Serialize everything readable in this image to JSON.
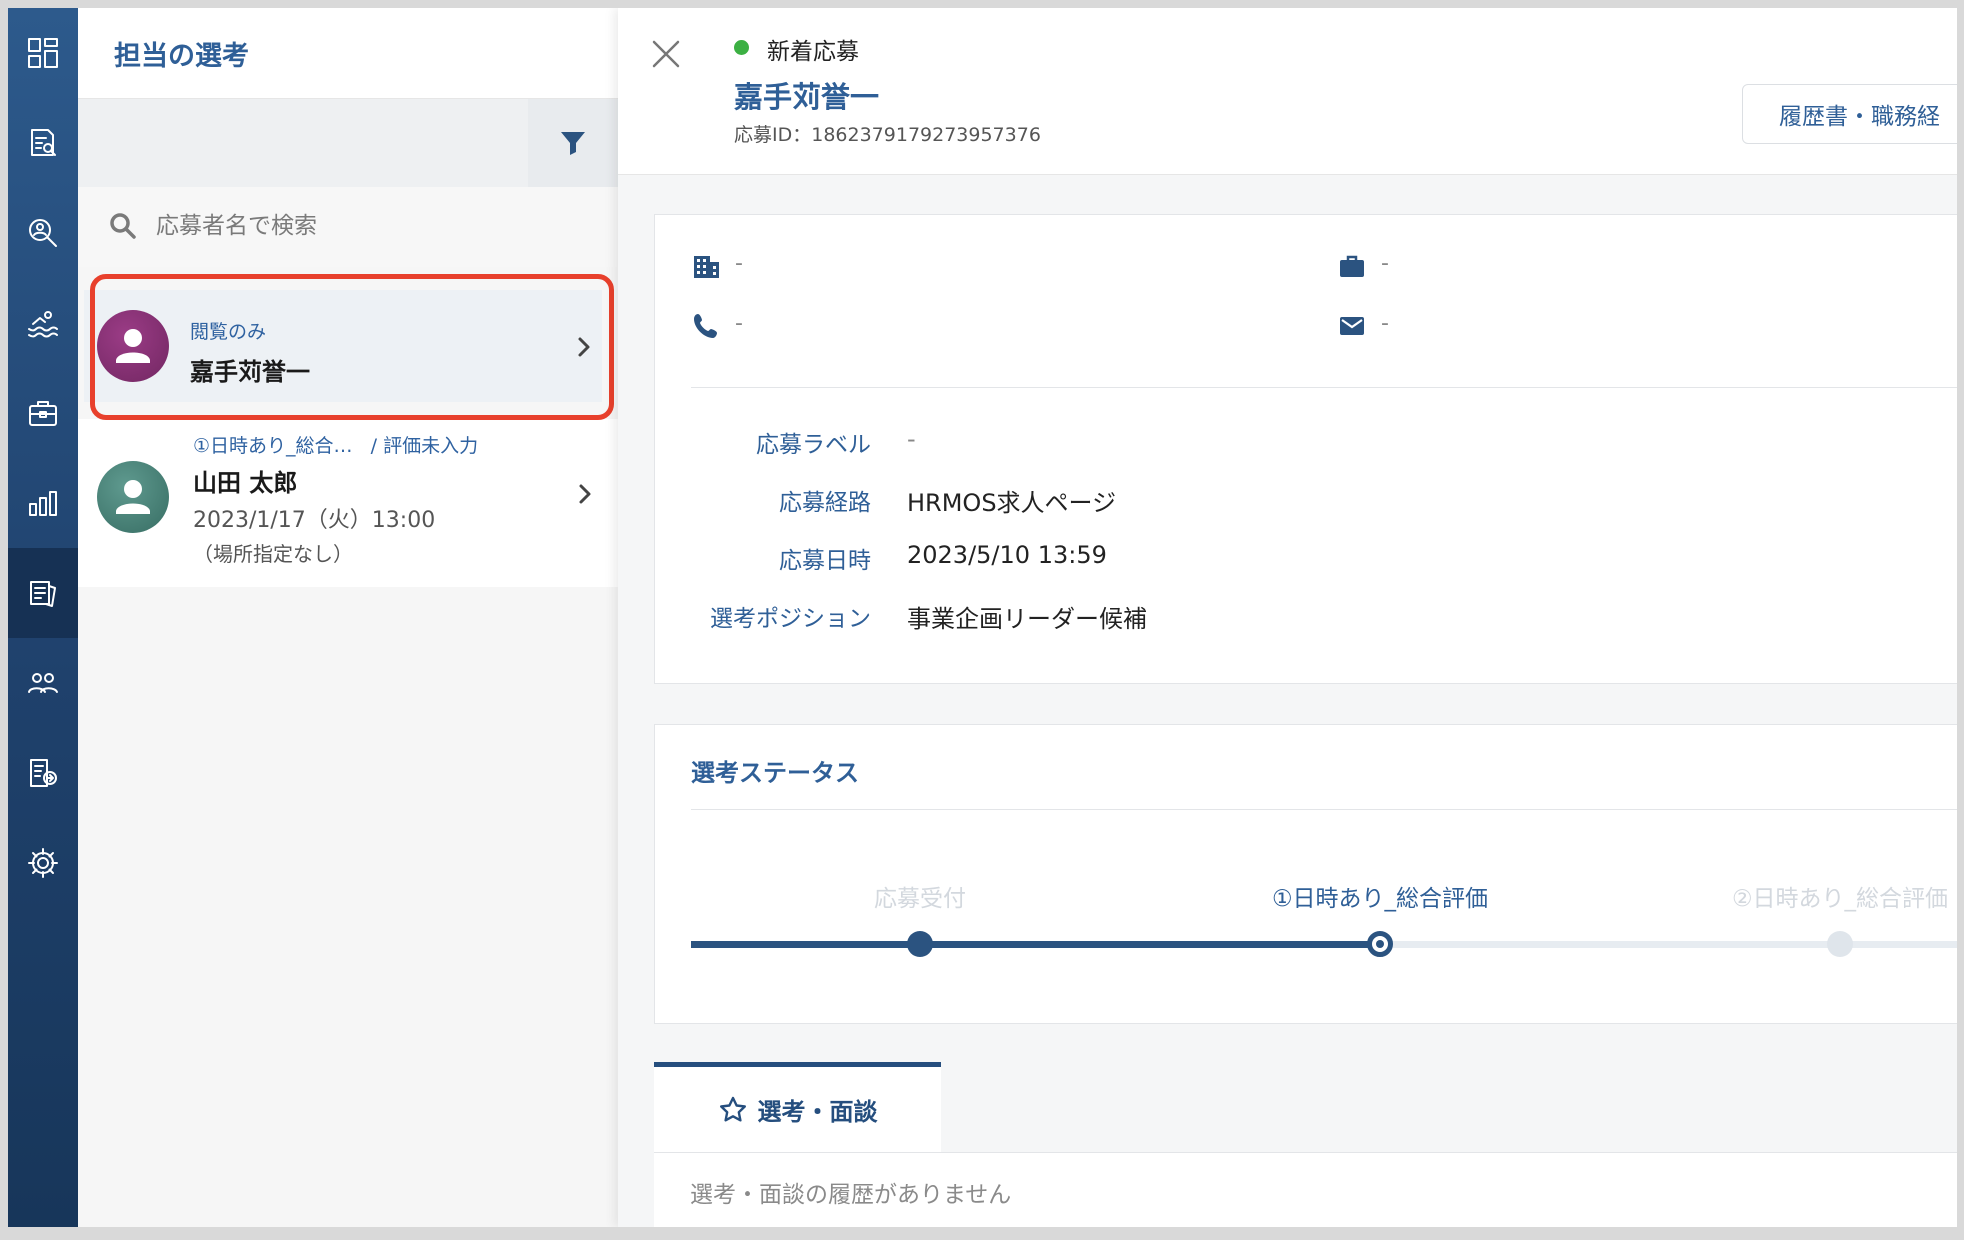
{
  "list": {
    "title": "担当の選考",
    "search_placeholder": "応募者名で検索",
    "cards": [
      {
        "badge": "閲覧のみ",
        "name": "嘉手苅誉一"
      },
      {
        "stage": "①日時あり_総合…",
        "evaluation": "/ 評価未入力",
        "name": "山田 太郎",
        "date": "2023/1/17（火）13:00",
        "place": "（場所指定なし）"
      }
    ]
  },
  "nav": {
    "items": [
      "dashboard-icon",
      "resume-search-icon",
      "candidate-search-icon",
      "swim-icon",
      "briefcase-icon",
      "bar-chart-icon",
      "selection-icon",
      "people-icon",
      "document-share-icon",
      "gear-icon"
    ],
    "active_index": 6
  },
  "detail": {
    "status": "新着応募",
    "status_color": "#3cb043",
    "name": "嘉手苅誉一",
    "application_id": "応募ID：1862379179273957376",
    "resume_button": "履歴書・職務経",
    "contact": {
      "company": "-",
      "job": "-",
      "phone": "-",
      "email": "-"
    },
    "fields": [
      {
        "label": "応募ラベル",
        "value": "-"
      },
      {
        "label": "応募経路",
        "value": "HRMOS求人ページ"
      },
      {
        "label": "応募日時",
        "value": "2023/5/10 13:59"
      },
      {
        "label": "選考ポジション",
        "value": "事業企画リーダー候補"
      }
    ],
    "status_section": {
      "title": "選考ステータス",
      "steps": [
        {
          "label": "応募受付",
          "state": "done"
        },
        {
          "label": "①日時あり_総合評価",
          "state": "current"
        },
        {
          "label": "②日時あり_総合評価",
          "state": "upcoming"
        }
      ]
    },
    "tab": {
      "label": "選考・面談",
      "empty_message": "選考・面談の履歴がありません"
    }
  },
  "colors": {
    "accent": "#2f5f97",
    "nav": "#1f416c",
    "highlight": "#e8402c"
  }
}
